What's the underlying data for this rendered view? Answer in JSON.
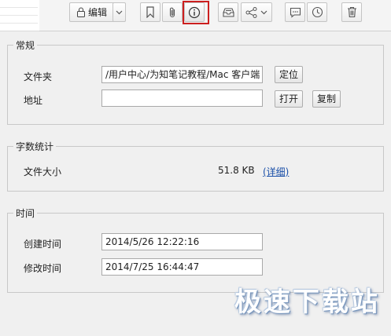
{
  "toolbar": {
    "edit_label": "编辑"
  },
  "general": {
    "legend": "常规",
    "folder_label": "文件夹",
    "folder_value": "/用户中心/为知笔记教程/Mac 客户端",
    "locate_button": "定位",
    "address_label": "地址",
    "address_value": "",
    "open_button": "打开",
    "copy_button": "复制"
  },
  "stats": {
    "legend": "字数统计",
    "size_label": "文件大小",
    "size_value": "51.8 KB",
    "details_link": "(详细)"
  },
  "time": {
    "legend": "时间",
    "created_label": "创建时间",
    "created_value": "2014/5/26 12:22:16",
    "modified_label": "修改时间",
    "modified_value": "2014/7/25 16:44:47"
  },
  "watermark": "极速下载站",
  "colors": {
    "highlight": "#cc1f1f",
    "link": "#1a4fa8"
  }
}
